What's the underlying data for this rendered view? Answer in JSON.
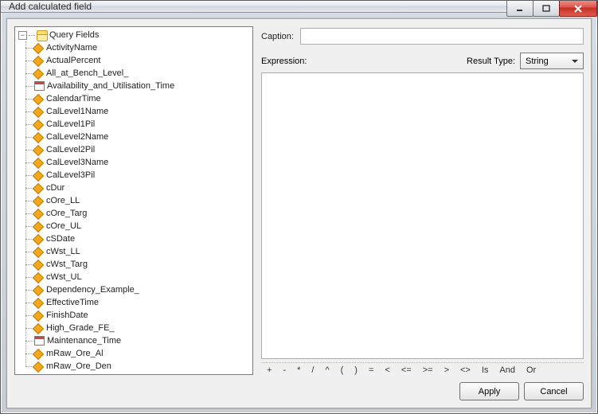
{
  "window": {
    "title": "Add calculated field"
  },
  "tree": {
    "root_label": "Query Fields",
    "fields": [
      {
        "label": "ActivityName",
        "icon": "tag"
      },
      {
        "label": "ActualPercent",
        "icon": "tag"
      },
      {
        "label": "All_at_Bench_Level_",
        "icon": "tag"
      },
      {
        "label": "Availability_and_Utilisation_Time",
        "icon": "cal"
      },
      {
        "label": "CalendarTime",
        "icon": "tag"
      },
      {
        "label": "CalLevel1Name",
        "icon": "tag"
      },
      {
        "label": "CalLevel1Pil",
        "icon": "tag"
      },
      {
        "label": "CalLevel2Name",
        "icon": "tag"
      },
      {
        "label": "CalLevel2Pil",
        "icon": "tag"
      },
      {
        "label": "CalLevel3Name",
        "icon": "tag"
      },
      {
        "label": "CalLevel3Pil",
        "icon": "tag"
      },
      {
        "label": "cDur",
        "icon": "tag"
      },
      {
        "label": "cOre_LL",
        "icon": "tag"
      },
      {
        "label": "cOre_Targ",
        "icon": "tag"
      },
      {
        "label": "cOre_UL",
        "icon": "tag"
      },
      {
        "label": "cSDate",
        "icon": "tag"
      },
      {
        "label": "cWst_LL",
        "icon": "tag"
      },
      {
        "label": "cWst_Targ",
        "icon": "tag"
      },
      {
        "label": "cWst_UL",
        "icon": "tag"
      },
      {
        "label": "Dependency_Example_",
        "icon": "tag"
      },
      {
        "label": "EffectiveTime",
        "icon": "tag"
      },
      {
        "label": "FinishDate",
        "icon": "tag"
      },
      {
        "label": "High_Grade_FE_",
        "icon": "tag"
      },
      {
        "label": "Maintenance_Time",
        "icon": "cal"
      },
      {
        "label": "mRaw_Ore_Al",
        "icon": "tag"
      },
      {
        "label": "mRaw_Ore_Den",
        "icon": "tag"
      }
    ]
  },
  "form": {
    "caption_label": "Caption:",
    "caption_value": "",
    "expression_label": "Expression:",
    "result_type_label": "Result Type:",
    "result_type_value": "String",
    "expression_value": ""
  },
  "operators": [
    "+",
    "-",
    "*",
    "/",
    "^",
    "(",
    ")",
    "=",
    "<",
    "<=",
    ">=",
    ">",
    "<>",
    "Is",
    "And",
    "Or"
  ],
  "buttons": {
    "apply": "Apply",
    "cancel": "Cancel"
  }
}
